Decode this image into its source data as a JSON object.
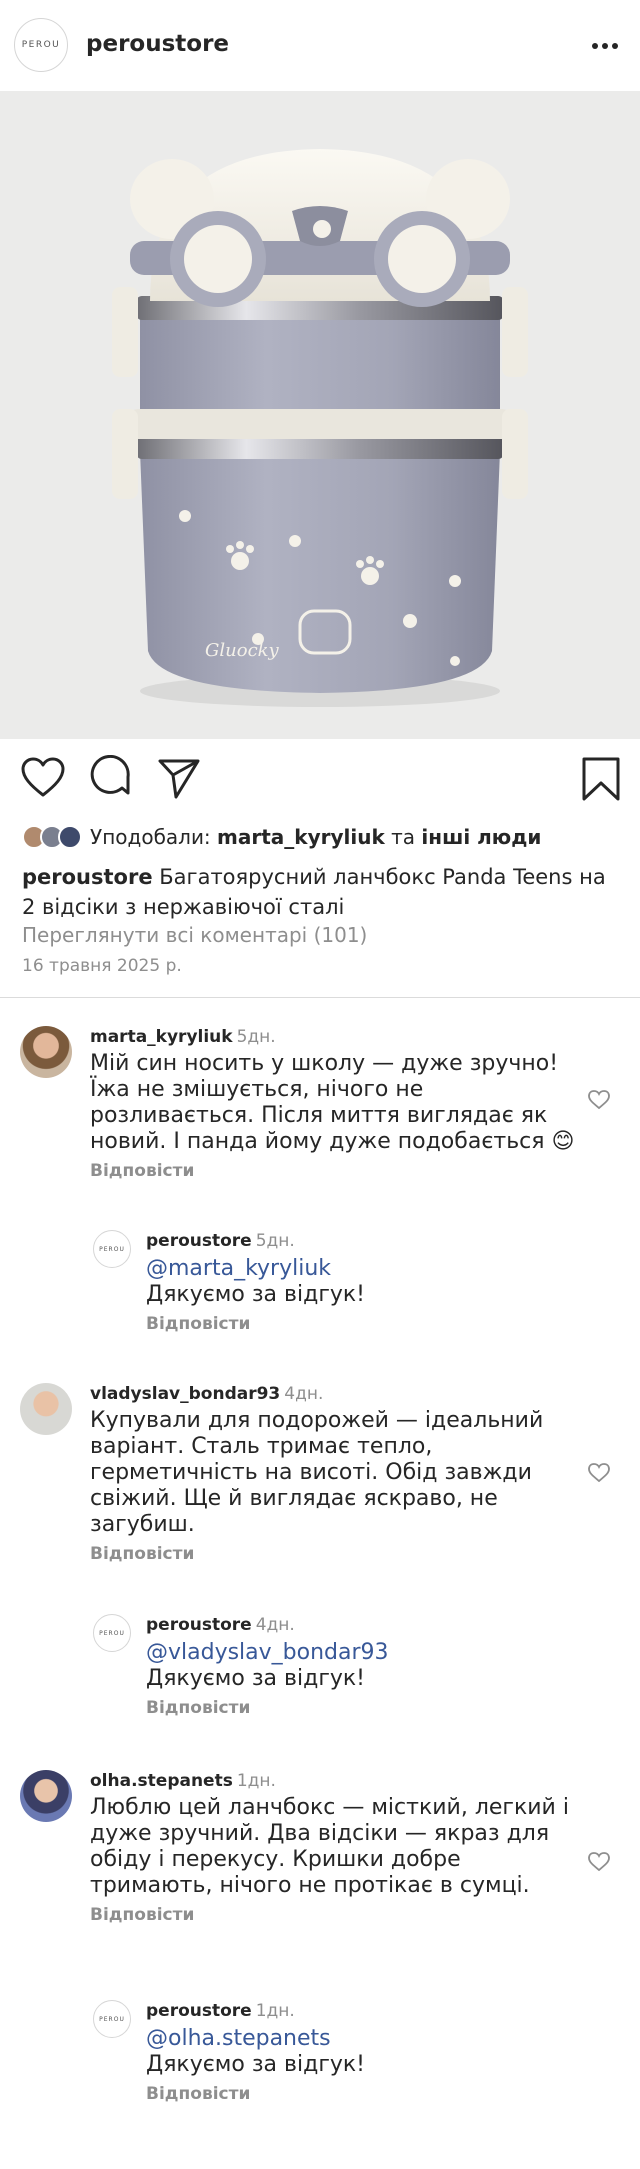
{
  "header": {
    "logo_text": "PEROU",
    "username": "peroustore"
  },
  "post": {
    "liked_by_prefix": "Уподобали:",
    "liked_by_user": "marta_kyryliuk",
    "liked_by_and": "та",
    "liked_by_rest": "інші люди",
    "caption_user": "peroustore",
    "caption_text": "Багатоярусний ланчбокс Panda Teens на 2 відсіки з нержавіючої сталі",
    "view_all": "Переглянути всі коментарі (101)",
    "date": "16 травня 2025 р."
  },
  "comments": [
    {
      "user": "marta_kyryliuk",
      "time": "5дн.",
      "text": "Мій син носить у школу — дуже зручно! Їжа не змішується, нічого не розливається. Після миття виглядає як новий. І панда йому дуже подобається 😊",
      "reply_label": "Відповісти",
      "reply": {
        "logo_text": "PEROU",
        "user": "peroustore",
        "time": "5дн.",
        "mention": "@marta_kyryliuk",
        "text": "Дякуємо за відгук!",
        "reply_label": "Відповісти"
      }
    },
    {
      "user": "vladyslav_bondar93",
      "time": "4дн.",
      "text": "Купували для подорожей — ідеальний варіант. Сталь тримає тепло, герметичність на висоті. Обід завжди свіжий. Ще й виглядає яскраво, не загубиш.",
      "reply_label": "Відповісти",
      "reply": {
        "logo_text": "PEROU",
        "user": "peroustore",
        "time": "4дн.",
        "mention": "@vladyslav_bondar93",
        "text": "Дякуємо за відгук!",
        "reply_label": "Відповісти"
      }
    },
    {
      "user": "olha.stepanets",
      "time": "1дн.",
      "text": "Люблю цей ланчбокс — місткий, легкий і дуже зручний. Два відсіки — якраз для обіду і перекусу. Кришки добре тримають, нічого не протікає в сумці.",
      "reply_label": "Відповісти",
      "reply": {
        "logo_text": "PEROU",
        "user": "peroustore",
        "time": "1дн.",
        "mention": "@olha.stepanets",
        "text": "Дякуємо за відгук!",
        "reply_label": "Відповісти"
      }
    }
  ],
  "colors": {
    "text": "#262626",
    "muted": "#8e8e8e",
    "mention": "#385898",
    "lunchbox_body": "#a3a5b6",
    "lunchbox_lid": "#f2efe6"
  }
}
